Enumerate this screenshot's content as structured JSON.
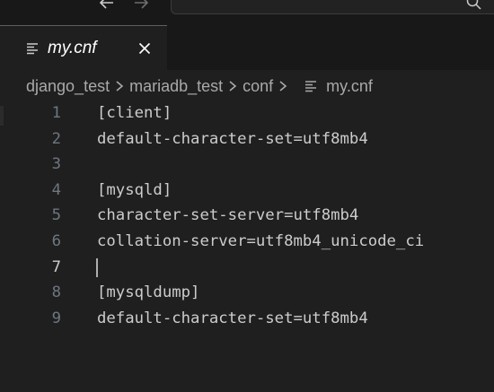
{
  "window": {
    "back_icon": "arrow-left-icon",
    "forward_icon": "arrow-right-icon",
    "search_icon": "search-icon"
  },
  "tab": {
    "label": "my.cnf",
    "icon": "settings-file-icon",
    "close_icon": "close-icon",
    "accent_color": "#0078d4"
  },
  "breadcrumb": {
    "items": [
      "django_test",
      "mariadb_test",
      "conf",
      "my.cnf"
    ],
    "separator_icon": "chevron-right-icon"
  },
  "editor": {
    "active_line": 7,
    "lines": [
      {
        "number": "1",
        "text": "[client]"
      },
      {
        "number": "2",
        "text": "default-character-set=utf8mb4"
      },
      {
        "number": "3",
        "text": ""
      },
      {
        "number": "4",
        "text": "[mysqld]"
      },
      {
        "number": "5",
        "text": "character-set-server=utf8mb4"
      },
      {
        "number": "6",
        "text": "collation-server=utf8mb4_unicode_ci"
      },
      {
        "number": "7",
        "text": ""
      },
      {
        "number": "8",
        "text": "[mysqldump]"
      },
      {
        "number": "9",
        "text": "default-character-set=utf8mb4"
      }
    ]
  }
}
